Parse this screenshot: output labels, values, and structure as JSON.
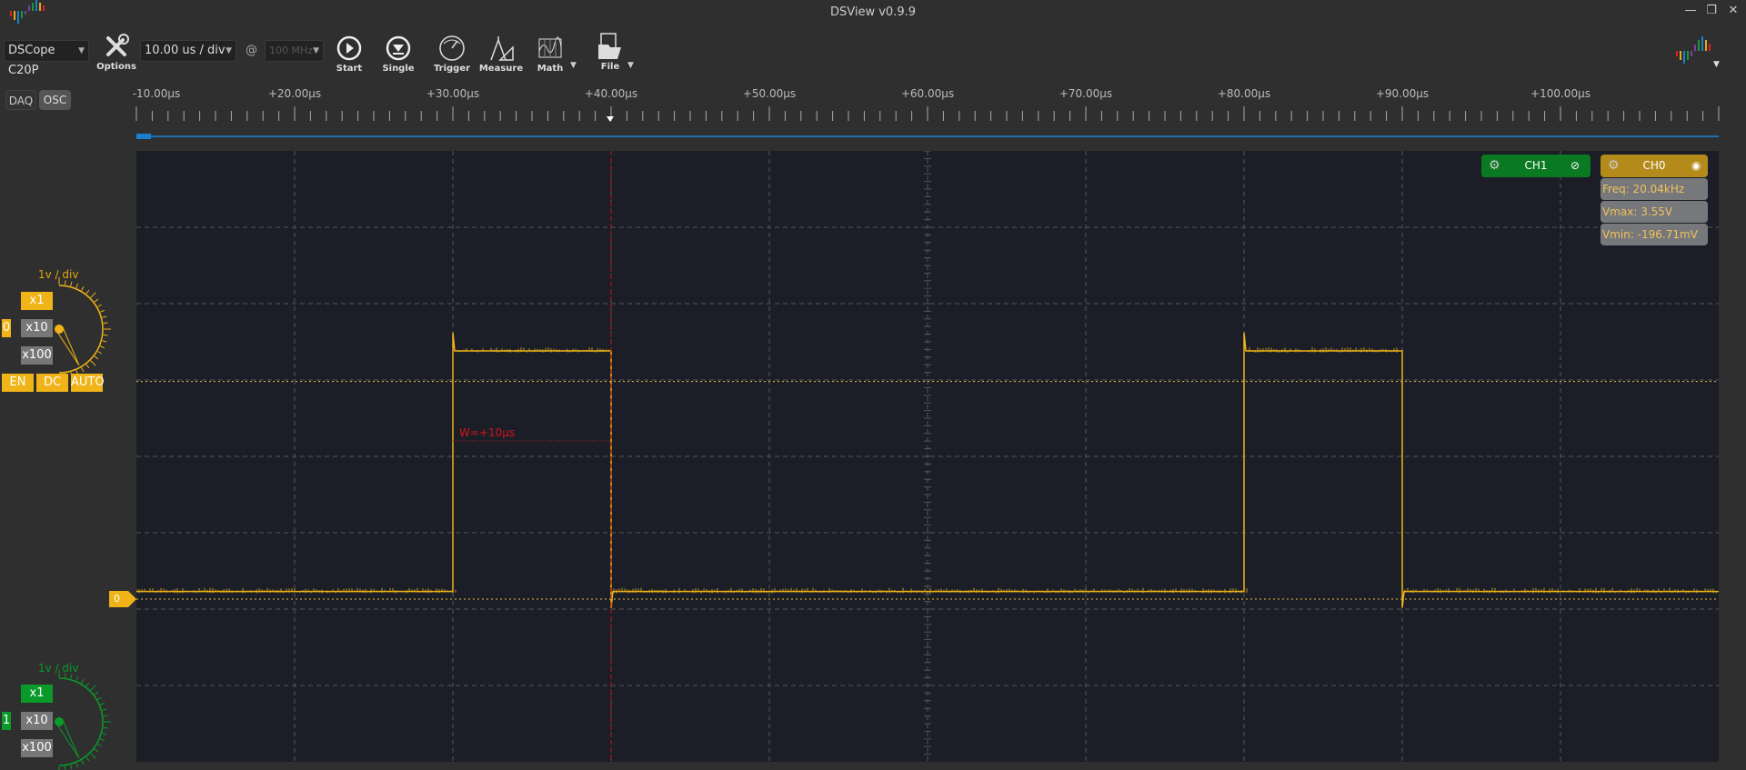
{
  "window": {
    "title": "DSView v0.9.9",
    "min": "—",
    "restore": "❐",
    "close": "✕"
  },
  "toolbar": {
    "device": "DSCope C20P",
    "options": "Options",
    "timebase": "10.00 us / div",
    "at": "@",
    "samplerate": "100 MHz",
    "start": "Start",
    "single": "Single",
    "trigger": "Trigger",
    "measure": "Measure",
    "math": "Math",
    "file": "File"
  },
  "mode": {
    "daq": "DAQ",
    "osc": "OSC"
  },
  "ruler": {
    "labels": [
      "-10.00µs",
      "+20.00µs",
      "+30.00µs",
      "+40.00µs",
      "+50.00µs",
      "+60.00µs",
      "+70.00µs",
      "+80.00µs",
      "+90.00µs",
      "+100.00µs"
    ]
  },
  "channels": {
    "ch0": {
      "name": "CH0",
      "color": "#f0b418",
      "vdiv": "1v / div",
      "x1": "x1",
      "x10": "x10",
      "x100": "x100",
      "index": "0",
      "en": "EN",
      "dc": "DC",
      "auto": "AUTO",
      "zero_label": "0"
    },
    "ch1": {
      "name": "CH1",
      "color": "#0a9a2a",
      "vdiv": "1v / div",
      "x1": "x1",
      "x10": "x10",
      "x100": "x100",
      "index": "1"
    }
  },
  "measurements": {
    "freq": "Freq: 20.04kHz",
    "vmax": "Vmax: 3.55V",
    "vmin": "Vmin: -196.71mV"
  },
  "cursor": {
    "label": "W=+10µs"
  },
  "waveform": {
    "t_start_us": 10,
    "us_per_div": 10,
    "v_per_div": 1,
    "low_v": 0.1,
    "high_v": 3.25,
    "trigger_v": 2.85,
    "edges_us": [
      [
        30,
        40
      ],
      [
        80,
        90
      ]
    ]
  }
}
